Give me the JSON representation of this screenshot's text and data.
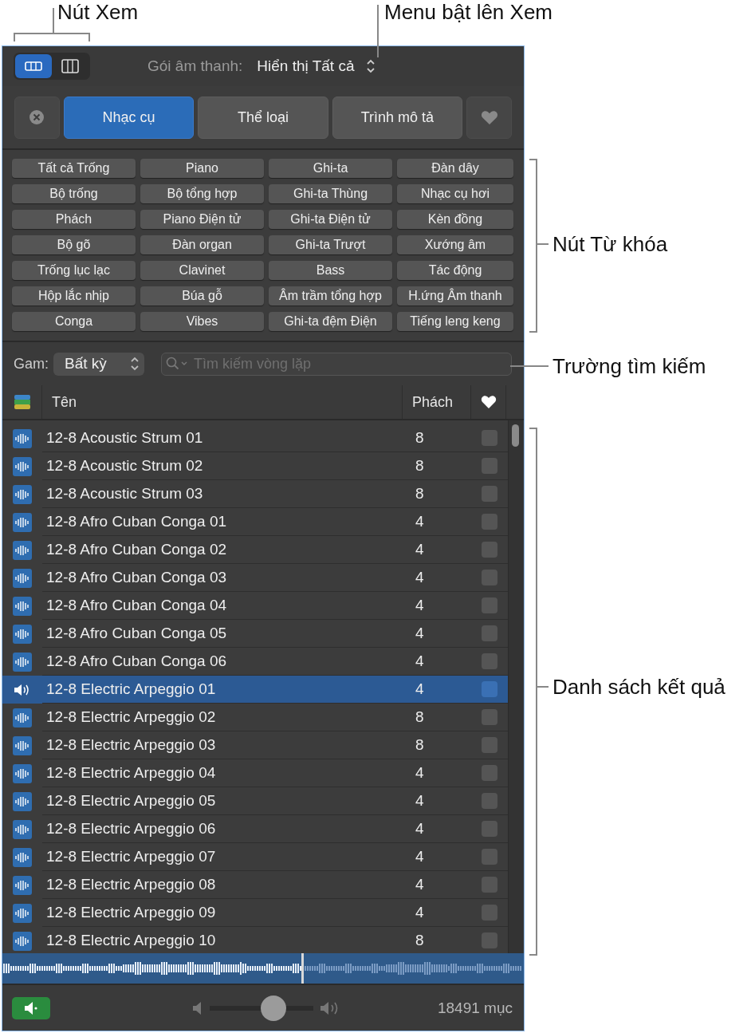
{
  "callouts": [
    {
      "text": "Nút Xem",
      "kind": "bracket-top"
    },
    {
      "text": "Menu bật lên Xem",
      "kind": "line-down"
    },
    {
      "text": "Nút Từ khóa",
      "kind": "bracket-side"
    },
    {
      "text": "Trường tìm kiếm",
      "kind": "line-side"
    },
    {
      "text": "Danh sách kết quả",
      "kind": "bracket-side"
    }
  ],
  "view_buttons": [
    {
      "kind": "rows",
      "selected": true
    },
    {
      "kind": "columns",
      "selected": false
    }
  ],
  "sound_pack": {
    "label": "Gói âm thanh:",
    "value": "Hiển thị Tất cả"
  },
  "filter_tabs": [
    {
      "label": "Nhạc cụ",
      "selected": true
    },
    {
      "label": "Thể loại",
      "selected": false
    },
    {
      "label": "Trình mô tả",
      "selected": false
    }
  ],
  "keywords": [
    {
      "label": "Tất cả Trống",
      "selected": false
    },
    {
      "label": "Piano",
      "selected": false
    },
    {
      "label": "Ghi-ta",
      "selected": false
    },
    {
      "label": "Đàn dây",
      "selected": false
    },
    {
      "label": "Bộ trống",
      "selected": false
    },
    {
      "label": "Bộ tổng hợp",
      "selected": false
    },
    {
      "label": "Ghi-ta Thùng",
      "selected": false
    },
    {
      "label": "Nhạc cụ hơi",
      "selected": false
    },
    {
      "label": "Phách",
      "selected": false
    },
    {
      "label": "Piano Điện tử",
      "selected": false
    },
    {
      "label": "Ghi-ta Điện tử",
      "selected": false
    },
    {
      "label": "Kèn đồng",
      "selected": false
    },
    {
      "label": "Bộ gõ",
      "selected": false
    },
    {
      "label": "Đàn organ",
      "selected": false
    },
    {
      "label": "Ghi-ta Trượt",
      "selected": false
    },
    {
      "label": "Xướng âm",
      "selected": false
    },
    {
      "label": "Trống lục lạc",
      "selected": false
    },
    {
      "label": "Clavinet",
      "selected": false
    },
    {
      "label": "Bass",
      "selected": false
    },
    {
      "label": "Tác động",
      "selected": false
    },
    {
      "label": "Hộp lắc nhịp",
      "selected": false
    },
    {
      "label": "Búa gỗ",
      "selected": false
    },
    {
      "label": "Âm trầm tổng hợp",
      "selected": false
    },
    {
      "label": "H.ứng Âm thanh",
      "selected": false
    },
    {
      "label": "Conga",
      "selected": false
    },
    {
      "label": "Vibes",
      "selected": false
    },
    {
      "label": "Ghi-ta đệm Điện",
      "selected": false
    },
    {
      "label": "Tiếng leng keng",
      "selected": false
    }
  ],
  "scale": {
    "label": "Gam:",
    "value": "Bất kỳ"
  },
  "search": {
    "placeholder": "Tìm kiếm vòng lặp"
  },
  "table": {
    "columns": [
      "Tên",
      "Phách"
    ],
    "rows": [
      {
        "name": "12-8 Acoustic Strum 01",
        "beats": "8",
        "selected": false,
        "playing": false,
        "favorite": false
      },
      {
        "name": "12-8 Acoustic Strum 02",
        "beats": "8",
        "selected": false,
        "playing": false,
        "favorite": false
      },
      {
        "name": "12-8 Acoustic Strum 03",
        "beats": "8",
        "selected": false,
        "playing": false,
        "favorite": false
      },
      {
        "name": "12-8 Afro Cuban Conga 01",
        "beats": "4",
        "selected": false,
        "playing": false,
        "favorite": false
      },
      {
        "name": "12-8 Afro Cuban Conga 02",
        "beats": "4",
        "selected": false,
        "playing": false,
        "favorite": false
      },
      {
        "name": "12-8 Afro Cuban Conga 03",
        "beats": "4",
        "selected": false,
        "playing": false,
        "favorite": false
      },
      {
        "name": "12-8 Afro Cuban Conga 04",
        "beats": "4",
        "selected": false,
        "playing": false,
        "favorite": false
      },
      {
        "name": "12-8 Afro Cuban Conga 05",
        "beats": "4",
        "selected": false,
        "playing": false,
        "favorite": false
      },
      {
        "name": "12-8 Afro Cuban Conga 06",
        "beats": "4",
        "selected": false,
        "playing": false,
        "favorite": false
      },
      {
        "name": "12-8 Electric Arpeggio 01",
        "beats": "4",
        "selected": true,
        "playing": true,
        "favorite": false
      },
      {
        "name": "12-8 Electric Arpeggio 02",
        "beats": "8",
        "selected": false,
        "playing": false,
        "favorite": false
      },
      {
        "name": "12-8 Electric Arpeggio 03",
        "beats": "8",
        "selected": false,
        "playing": false,
        "favorite": false
      },
      {
        "name": "12-8 Electric Arpeggio 04",
        "beats": "4",
        "selected": false,
        "playing": false,
        "favorite": false
      },
      {
        "name": "12-8 Electric Arpeggio 05",
        "beats": "4",
        "selected": false,
        "playing": false,
        "favorite": false
      },
      {
        "name": "12-8 Electric Arpeggio 06",
        "beats": "4",
        "selected": false,
        "playing": false,
        "favorite": false
      },
      {
        "name": "12-8 Electric Arpeggio 07",
        "beats": "4",
        "selected": false,
        "playing": false,
        "favorite": false
      },
      {
        "name": "12-8 Electric Arpeggio 08",
        "beats": "4",
        "selected": false,
        "playing": false,
        "favorite": false
      },
      {
        "name": "12-8 Electric Arpeggio 09",
        "beats": "4",
        "selected": false,
        "playing": false,
        "favorite": false
      },
      {
        "name": "12-8 Electric Arpeggio 10",
        "beats": "8",
        "selected": false,
        "playing": false,
        "favorite": false
      }
    ]
  },
  "volume": {
    "level": 0.65
  },
  "item_count": "18491 mục"
}
